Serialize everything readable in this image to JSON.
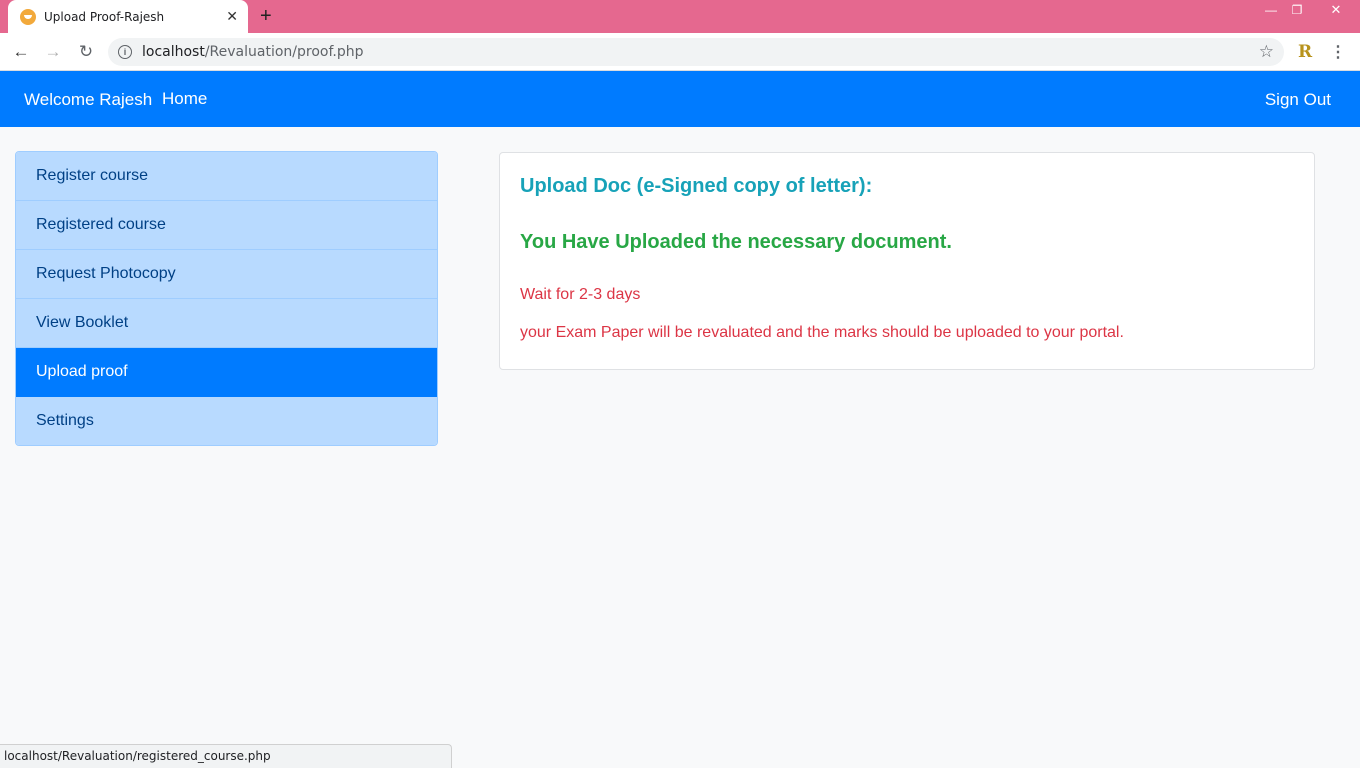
{
  "browser": {
    "tab_title": "Upload Proof-Rajesh",
    "url_host": "localhost",
    "url_path": "/Revaluation/proof.php",
    "new_tab_icon": "plus-icon",
    "extension_letter": "R",
    "status_url": "localhost/Revaluation/registered_course.php"
  },
  "navbar": {
    "brand": "Welcome Rajesh",
    "home": "Home",
    "sign_out": "Sign Out",
    "color": "#007bff"
  },
  "sidebar": {
    "items": [
      {
        "label": "Register course",
        "active": false
      },
      {
        "label": "Registered course",
        "active": false
      },
      {
        "label": "Request Photocopy",
        "active": false
      },
      {
        "label": "View Booklet",
        "active": false
      },
      {
        "label": "Upload proof",
        "active": true
      },
      {
        "label": "Settings",
        "active": false
      }
    ]
  },
  "main": {
    "heading": "Upload Doc (e-Signed copy of letter):",
    "success_message": "You Have Uploaded the necessary document.",
    "wait_message": "Wait for 2-3 days",
    "note_message": "your Exam Paper will be revaluated and the marks should be uploaded to your portal."
  },
  "colors": {
    "info": "#17a2b8",
    "success": "#28a745",
    "danger": "#dc3545",
    "sidebar_bg": "#b8daff",
    "tab_strip": "#e5688f"
  }
}
